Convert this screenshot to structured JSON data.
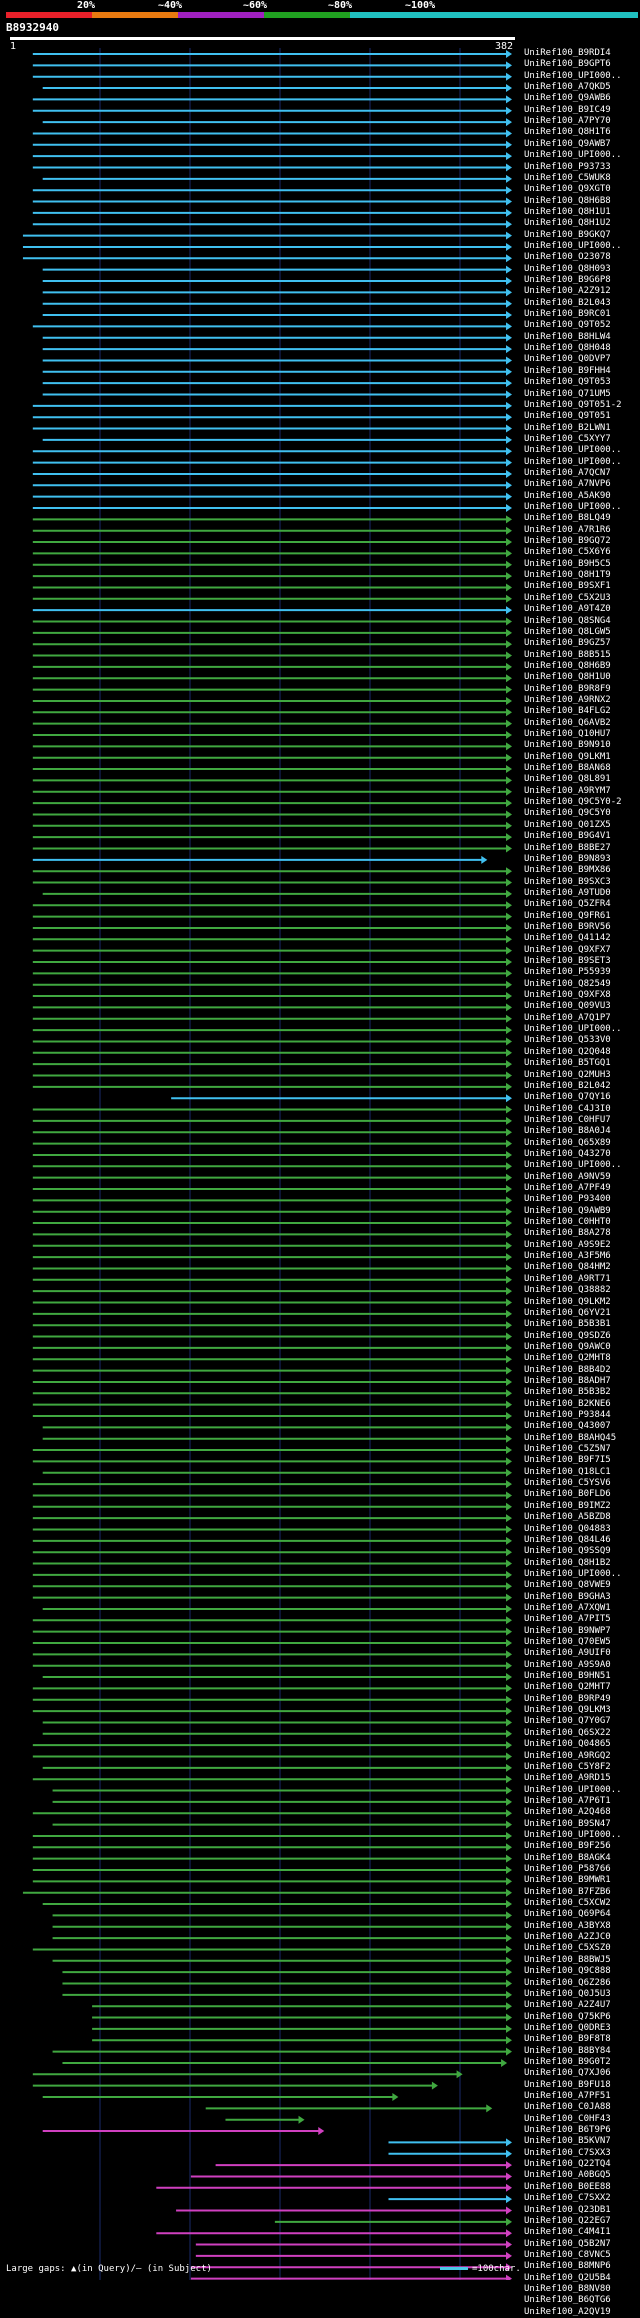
{
  "header": {
    "percent_labels": [
      "20%",
      "~40%",
      "~60%",
      "~80%",
      "~100%"
    ],
    "identity_colors": [
      "#e8202a",
      "#e87a10",
      "#a020c0",
      "#20a020",
      "#20c0c0"
    ],
    "query_id": "B8932940",
    "query_start": "1",
    "query_end": "382"
  },
  "colors": {
    "cyan": "#40c0f0",
    "green": "#40a840",
    "magenta": "#d040c0",
    "grid": "#1a2a6a"
  },
  "rows": [
    {
      "id": "UniRef100_B9RDI4",
      "c": "cyan",
      "s": 0.03,
      "e": 1.0
    },
    {
      "id": "UniRef100_B9GPT6",
      "c": "cyan",
      "s": 0.03,
      "e": 1.0
    },
    {
      "id": "UniRef100_UPI000..",
      "c": "cyan",
      "s": 0.03,
      "e": 1.0
    },
    {
      "id": "UniRef100_A7QKD5",
      "c": "cyan",
      "s": 0.05,
      "e": 1.0
    },
    {
      "id": "UniRef100_Q9AWB6",
      "c": "cyan",
      "s": 0.03,
      "e": 1.0
    },
    {
      "id": "UniRef100_B9IC49",
      "c": "cyan",
      "s": 0.03,
      "e": 1.0
    },
    {
      "id": "UniRef100_A7PY70",
      "c": "cyan",
      "s": 0.05,
      "e": 1.0
    },
    {
      "id": "UniRef100_Q8H1T6",
      "c": "cyan",
      "s": 0.03,
      "e": 1.0
    },
    {
      "id": "UniRef100_Q9AWB7",
      "c": "cyan",
      "s": 0.03,
      "e": 1.0
    },
    {
      "id": "UniRef100_UPI000..",
      "c": "cyan",
      "s": 0.03,
      "e": 1.0
    },
    {
      "id": "UniRef100_P93733",
      "c": "cyan",
      "s": 0.03,
      "e": 1.0
    },
    {
      "id": "UniRef100_C5WUK8",
      "c": "cyan",
      "s": 0.05,
      "e": 1.0
    },
    {
      "id": "UniRef100_Q9XGT0",
      "c": "cyan",
      "s": 0.03,
      "e": 1.0
    },
    {
      "id": "UniRef100_Q8H6B8",
      "c": "cyan",
      "s": 0.03,
      "e": 1.0
    },
    {
      "id": "UniRef100_Q8H1U1",
      "c": "cyan",
      "s": 0.03,
      "e": 1.0
    },
    {
      "id": "UniRef100_Q8H1U2",
      "c": "cyan",
      "s": 0.03,
      "e": 1.0
    },
    {
      "id": "UniRef100_B9GKQ7",
      "c": "cyan",
      "s": 0.01,
      "e": 1.0
    },
    {
      "id": "UniRef100_UPI000..",
      "c": "cyan",
      "s": 0.01,
      "e": 1.0
    },
    {
      "id": "UniRef100_O23078",
      "c": "cyan",
      "s": 0.01,
      "e": 1.0
    },
    {
      "id": "UniRef100_Q8H093",
      "c": "cyan",
      "s": 0.05,
      "e": 1.0
    },
    {
      "id": "UniRef100_B9G6P8",
      "c": "cyan",
      "s": 0.05,
      "e": 1.0
    },
    {
      "id": "UniRef100_A2Z912",
      "c": "cyan",
      "s": 0.05,
      "e": 1.0
    },
    {
      "id": "UniRef100_B2L043",
      "c": "cyan",
      "s": 0.05,
      "e": 1.0
    },
    {
      "id": "UniRef100_B9RC01",
      "c": "cyan",
      "s": 0.05,
      "e": 1.0
    },
    {
      "id": "UniRef100_Q9T052",
      "c": "cyan",
      "s": 0.03,
      "e": 1.0
    },
    {
      "id": "UniRef100_B8HLW4",
      "c": "cyan",
      "s": 0.05,
      "e": 1.0
    },
    {
      "id": "UniRef100_Q8H048",
      "c": "cyan",
      "s": 0.05,
      "e": 1.0
    },
    {
      "id": "UniRef100_Q0DVP7",
      "c": "cyan",
      "s": 0.05,
      "e": 1.0
    },
    {
      "id": "UniRef100_B9FHH4",
      "c": "cyan",
      "s": 0.05,
      "e": 1.0
    },
    {
      "id": "UniRef100_Q9T053",
      "c": "cyan",
      "s": 0.05,
      "e": 1.0
    },
    {
      "id": "UniRef100_Q71UM5",
      "c": "cyan",
      "s": 0.05,
      "e": 1.0
    },
    {
      "id": "UniRef100_Q9T051-2",
      "c": "cyan",
      "s": 0.03,
      "e": 1.0
    },
    {
      "id": "UniRef100_Q9T051",
      "c": "cyan",
      "s": 0.03,
      "e": 1.0
    },
    {
      "id": "UniRef100_B2LWN1",
      "c": "cyan",
      "s": 0.03,
      "e": 1.0
    },
    {
      "id": "UniRef100_C5XYY7",
      "c": "cyan",
      "s": 0.05,
      "e": 1.0
    },
    {
      "id": "UniRef100_UPI000..",
      "c": "cyan",
      "s": 0.03,
      "e": 1.0
    },
    {
      "id": "UniRef100_UPI000..",
      "c": "cyan",
      "s": 0.03,
      "e": 1.0
    },
    {
      "id": "UniRef100_A7QCN7",
      "c": "cyan",
      "s": 0.03,
      "e": 1.0
    },
    {
      "id": "UniRef100_A7NVP6",
      "c": "cyan",
      "s": 0.03,
      "e": 1.0
    },
    {
      "id": "UniRef100_A5AK90",
      "c": "cyan",
      "s": 0.03,
      "e": 1.0
    },
    {
      "id": "UniRef100_UPI000..",
      "c": "cyan",
      "s": 0.03,
      "e": 1.0
    },
    {
      "id": "UniRef100_B8LQ49",
      "c": "green",
      "s": 0.03,
      "e": 1.0
    },
    {
      "id": "UniRef100_A7R1R6",
      "c": "green",
      "s": 0.03,
      "e": 1.0
    },
    {
      "id": "UniRef100_B9GQ72",
      "c": "green",
      "s": 0.03,
      "e": 1.0
    },
    {
      "id": "UniRef100_C5X6Y6",
      "c": "green",
      "s": 0.03,
      "e": 1.0
    },
    {
      "id": "UniRef100_B9H5C5",
      "c": "green",
      "s": 0.03,
      "e": 1.0
    },
    {
      "id": "UniRef100_Q8H1T9",
      "c": "green",
      "s": 0.03,
      "e": 1.0
    },
    {
      "id": "UniRef100_B9SXF1",
      "c": "green",
      "s": 0.03,
      "e": 1.0
    },
    {
      "id": "UniRef100_C5X2U3",
      "c": "green",
      "s": 0.03,
      "e": 1.0
    },
    {
      "id": "UniRef100_A9T4Z0",
      "c": "cyan",
      "s": 0.03,
      "e": 1.0
    },
    {
      "id": "UniRef100_Q8SNG4",
      "c": "green",
      "s": 0.03,
      "e": 1.0
    },
    {
      "id": "UniRef100_Q8LGW5",
      "c": "green",
      "s": 0.03,
      "e": 1.0
    },
    {
      "id": "UniRef100_B9GZ57",
      "c": "green",
      "s": 0.03,
      "e": 1.0
    },
    {
      "id": "UniRef100_B8B515",
      "c": "green",
      "s": 0.03,
      "e": 1.0
    },
    {
      "id": "UniRef100_Q8H6B9",
      "c": "green",
      "s": 0.03,
      "e": 1.0
    },
    {
      "id": "UniRef100_Q8H1U0",
      "c": "green",
      "s": 0.03,
      "e": 1.0
    },
    {
      "id": "UniRef100_B9R8F9",
      "c": "green",
      "s": 0.03,
      "e": 1.0
    },
    {
      "id": "UniRef100_A9RNX2",
      "c": "green",
      "s": 0.03,
      "e": 1.0
    },
    {
      "id": "UniRef100_B4FLG2",
      "c": "green",
      "s": 0.03,
      "e": 1.0
    },
    {
      "id": "UniRef100_Q6AVB2",
      "c": "green",
      "s": 0.03,
      "e": 1.0
    },
    {
      "id": "UniRef100_Q10HU7",
      "c": "green",
      "s": 0.03,
      "e": 1.0
    },
    {
      "id": "UniRef100_B9N910",
      "c": "green",
      "s": 0.03,
      "e": 1.0
    },
    {
      "id": "UniRef100_Q9LKM1",
      "c": "green",
      "s": 0.03,
      "e": 1.0
    },
    {
      "id": "UniRef100_B8AN68",
      "c": "green",
      "s": 0.03,
      "e": 1.0
    },
    {
      "id": "UniRef100_Q8L891",
      "c": "green",
      "s": 0.03,
      "e": 1.0
    },
    {
      "id": "UniRef100_A9RYM7",
      "c": "green",
      "s": 0.03,
      "e": 1.0
    },
    {
      "id": "UniRef100_Q9C5Y0-2",
      "c": "green",
      "s": 0.03,
      "e": 1.0
    },
    {
      "id": "UniRef100_Q9C5Y0",
      "c": "green",
      "s": 0.03,
      "e": 1.0
    },
    {
      "id": "UniRef100_Q01ZX5",
      "c": "green",
      "s": 0.03,
      "e": 1.0
    },
    {
      "id": "UniRef100_B9G4V1",
      "c": "green",
      "s": 0.03,
      "e": 1.0
    },
    {
      "id": "UniRef100_B8BE27",
      "c": "green",
      "s": 0.03,
      "e": 1.0
    },
    {
      "id": "UniRef100_B9N893",
      "c": "cyan",
      "s": 0.03,
      "e": 0.95
    },
    {
      "id": "UniRef100_B9MX86",
      "c": "green",
      "s": 0.03,
      "e": 1.0
    },
    {
      "id": "UniRef100_B9SXC3",
      "c": "green",
      "s": 0.03,
      "e": 1.0
    },
    {
      "id": "UniRef100_A9TUD0",
      "c": "green",
      "s": 0.05,
      "e": 1.0
    },
    {
      "id": "UniRef100_Q5ZFR4",
      "c": "green",
      "s": 0.03,
      "e": 1.0
    },
    {
      "id": "UniRef100_Q9FR61",
      "c": "green",
      "s": 0.03,
      "e": 1.0
    },
    {
      "id": "UniRef100_B9RV56",
      "c": "green",
      "s": 0.03,
      "e": 1.0
    },
    {
      "id": "UniRef100_Q41142",
      "c": "green",
      "s": 0.03,
      "e": 1.0
    },
    {
      "id": "UniRef100_Q9XFX7",
      "c": "green",
      "s": 0.03,
      "e": 1.0
    },
    {
      "id": "UniRef100_B9SET3",
      "c": "green",
      "s": 0.03,
      "e": 1.0
    },
    {
      "id": "UniRef100_P55939",
      "c": "green",
      "s": 0.03,
      "e": 1.0
    },
    {
      "id": "UniRef100_Q82549",
      "c": "green",
      "s": 0.03,
      "e": 1.0
    },
    {
      "id": "UniRef100_Q9XFX8",
      "c": "green",
      "s": 0.03,
      "e": 1.0
    },
    {
      "id": "UniRef100_Q09VU3",
      "c": "green",
      "s": 0.03,
      "e": 1.0
    },
    {
      "id": "UniRef100_A7Q1P7",
      "c": "green",
      "s": 0.03,
      "e": 1.0
    },
    {
      "id": "UniRef100_UPI000..",
      "c": "green",
      "s": 0.03,
      "e": 1.0
    },
    {
      "id": "UniRef100_Q533V0",
      "c": "green",
      "s": 0.03,
      "e": 1.0
    },
    {
      "id": "UniRef100_Q2Q048",
      "c": "green",
      "s": 0.03,
      "e": 1.0
    },
    {
      "id": "UniRef100_B5TGQ1",
      "c": "green",
      "s": 0.03,
      "e": 1.0
    },
    {
      "id": "UniRef100_Q2MUH3",
      "c": "green",
      "s": 0.03,
      "e": 1.0
    },
    {
      "id": "UniRef100_B2L042",
      "c": "green",
      "s": 0.03,
      "e": 1.0
    },
    {
      "id": "UniRef100_Q7QY16",
      "c": "cyan",
      "s": 0.31,
      "e": 1.0
    },
    {
      "id": "UniRef100_C4J3I0",
      "c": "green",
      "s": 0.03,
      "e": 1.0
    },
    {
      "id": "UniRef100_C0HFU7",
      "c": "green",
      "s": 0.03,
      "e": 1.0
    },
    {
      "id": "UniRef100_B8A0J4",
      "c": "green",
      "s": 0.03,
      "e": 1.0
    },
    {
      "id": "UniRef100_Q65X89",
      "c": "green",
      "s": 0.03,
      "e": 1.0
    },
    {
      "id": "UniRef100_Q43270",
      "c": "green",
      "s": 0.03,
      "e": 1.0
    },
    {
      "id": "UniRef100_UPI000..",
      "c": "green",
      "s": 0.03,
      "e": 1.0
    },
    {
      "id": "UniRef100_A9NV59",
      "c": "green",
      "s": 0.03,
      "e": 1.0
    },
    {
      "id": "UniRef100_A7PF49",
      "c": "green",
      "s": 0.03,
      "e": 1.0
    },
    {
      "id": "UniRef100_P93400",
      "c": "green",
      "s": 0.03,
      "e": 1.0
    },
    {
      "id": "UniRef100_Q9AWB9",
      "c": "green",
      "s": 0.03,
      "e": 1.0
    },
    {
      "id": "UniRef100_C0HHT0",
      "c": "green",
      "s": 0.03,
      "e": 1.0
    },
    {
      "id": "UniRef100_B8A278",
      "c": "green",
      "s": 0.03,
      "e": 1.0
    },
    {
      "id": "UniRef100_A9S9E2",
      "c": "green",
      "s": 0.03,
      "e": 1.0
    },
    {
      "id": "UniRef100_A3F5M6",
      "c": "green",
      "s": 0.03,
      "e": 1.0
    },
    {
      "id": "UniRef100_Q84HM2",
      "c": "green",
      "s": 0.03,
      "e": 1.0
    },
    {
      "id": "UniRef100_A9RT71",
      "c": "green",
      "s": 0.03,
      "e": 1.0
    },
    {
      "id": "UniRef100_Q38882",
      "c": "green",
      "s": 0.03,
      "e": 1.0
    },
    {
      "id": "UniRef100_Q9LKM2",
      "c": "green",
      "s": 0.03,
      "e": 1.0
    },
    {
      "id": "UniRef100_Q6YV21",
      "c": "green",
      "s": 0.03,
      "e": 1.0
    },
    {
      "id": "UniRef100_B5B3B1",
      "c": "green",
      "s": 0.03,
      "e": 1.0
    },
    {
      "id": "UniRef100_Q9SDZ6",
      "c": "green",
      "s": 0.03,
      "e": 1.0
    },
    {
      "id": "UniRef100_Q9AWC0",
      "c": "green",
      "s": 0.03,
      "e": 1.0
    },
    {
      "id": "UniRef100_Q2MHT8",
      "c": "green",
      "s": 0.03,
      "e": 1.0
    },
    {
      "id": "UniRef100_B8B4D2",
      "c": "green",
      "s": 0.03,
      "e": 1.0
    },
    {
      "id": "UniRef100_B8ADH7",
      "c": "green",
      "s": 0.03,
      "e": 1.0
    },
    {
      "id": "UniRef100_B5B3B2",
      "c": "green",
      "s": 0.03,
      "e": 1.0
    },
    {
      "id": "UniRef100_B2KNE6",
      "c": "green",
      "s": 0.03,
      "e": 1.0
    },
    {
      "id": "UniRef100_P93844",
      "c": "green",
      "s": 0.03,
      "e": 1.0
    },
    {
      "id": "UniRef100_Q43007",
      "c": "green",
      "s": 0.05,
      "e": 1.0
    },
    {
      "id": "UniRef100_B8AHQ45",
      "c": "green",
      "s": 0.05,
      "e": 1.0
    },
    {
      "id": "UniRef100_C5Z5N7",
      "c": "green",
      "s": 0.03,
      "e": 1.0
    },
    {
      "id": "UniRef100_B9F7I5",
      "c": "green",
      "s": 0.03,
      "e": 1.0
    },
    {
      "id": "UniRef100_Q18LC1",
      "c": "green",
      "s": 0.05,
      "e": 1.0
    },
    {
      "id": "UniRef100_C5YSV6",
      "c": "green",
      "s": 0.03,
      "e": 1.0
    },
    {
      "id": "UniRef100_B0FLD6",
      "c": "green",
      "s": 0.03,
      "e": 1.0
    },
    {
      "id": "UniRef100_B9IMZ2",
      "c": "green",
      "s": 0.03,
      "e": 1.0
    },
    {
      "id": "UniRef100_A5BZD8",
      "c": "green",
      "s": 0.03,
      "e": 1.0
    },
    {
      "id": "UniRef100_Q04883",
      "c": "green",
      "s": 0.03,
      "e": 1.0
    },
    {
      "id": "UniRef100_Q84L46",
      "c": "green",
      "s": 0.03,
      "e": 1.0
    },
    {
      "id": "UniRef100_Q9SSQ9",
      "c": "green",
      "s": 0.03,
      "e": 1.0
    },
    {
      "id": "UniRef100_Q8H1B2",
      "c": "green",
      "s": 0.03,
      "e": 1.0
    },
    {
      "id": "UniRef100_UPI000..",
      "c": "green",
      "s": 0.03,
      "e": 1.0
    },
    {
      "id": "UniRef100_Q8VWE9",
      "c": "green",
      "s": 0.03,
      "e": 1.0
    },
    {
      "id": "UniRef100_B9GHA3",
      "c": "green",
      "s": 0.03,
      "e": 1.0
    },
    {
      "id": "UniRef100_A7XQW1",
      "c": "green",
      "s": 0.05,
      "e": 1.0
    },
    {
      "id": "UniRef100_A7PIT5",
      "c": "green",
      "s": 0.03,
      "e": 1.0
    },
    {
      "id": "UniRef100_B9NWP7",
      "c": "green",
      "s": 0.03,
      "e": 1.0
    },
    {
      "id": "UniRef100_Q70EW5",
      "c": "green",
      "s": 0.03,
      "e": 1.0
    },
    {
      "id": "UniRef100_A9UIF0",
      "c": "green",
      "s": 0.03,
      "e": 1.0
    },
    {
      "id": "UniRef100_A9S9A0",
      "c": "green",
      "s": 0.03,
      "e": 1.0
    },
    {
      "id": "UniRef100_B9HN51",
      "c": "green",
      "s": 0.05,
      "e": 1.0
    },
    {
      "id": "UniRef100_Q2MHT7",
      "c": "green",
      "s": 0.03,
      "e": 1.0
    },
    {
      "id": "UniRef100_B9RP49",
      "c": "green",
      "s": 0.03,
      "e": 1.0
    },
    {
      "id": "UniRef100_Q9LKM3",
      "c": "green",
      "s": 0.03,
      "e": 1.0
    },
    {
      "id": "UniRef100_Q7Y0G7",
      "c": "green",
      "s": 0.05,
      "e": 1.0
    },
    {
      "id": "UniRef100_Q6SX22",
      "c": "green",
      "s": 0.05,
      "e": 1.0
    },
    {
      "id": "UniRef100_Q04865",
      "c": "green",
      "s": 0.03,
      "e": 1.0
    },
    {
      "id": "UniRef100_A9RGQ2",
      "c": "green",
      "s": 0.03,
      "e": 1.0
    },
    {
      "id": "UniRef100_C5Y8F2",
      "c": "green",
      "s": 0.05,
      "e": 1.0
    },
    {
      "id": "UniRef100_A9RD15",
      "c": "green",
      "s": 0.03,
      "e": 1.0
    },
    {
      "id": "UniRef100_UPI000..",
      "c": "green",
      "s": 0.07,
      "e": 1.0
    },
    {
      "id": "UniRef100_A7P6T1",
      "c": "green",
      "s": 0.07,
      "e": 1.0
    },
    {
      "id": "UniRef100_A2Q468",
      "c": "green",
      "s": 0.03,
      "e": 1.0
    },
    {
      "id": "UniRef100_B9SN47",
      "c": "green",
      "s": 0.07,
      "e": 1.0
    },
    {
      "id": "UniRef100_UPI000..",
      "c": "green",
      "s": 0.03,
      "e": 1.0
    },
    {
      "id": "UniRef100_B9F256",
      "c": "green",
      "s": 0.03,
      "e": 1.0
    },
    {
      "id": "UniRef100_B8AGK4",
      "c": "green",
      "s": 0.03,
      "e": 1.0
    },
    {
      "id": "UniRef100_P58766",
      "c": "green",
      "s": 0.03,
      "e": 1.0
    },
    {
      "id": "UniRef100_B9MWR1",
      "c": "green",
      "s": 0.03,
      "e": 1.0
    },
    {
      "id": "UniRef100_B7FZB6",
      "c": "green",
      "s": 0.01,
      "e": 1.0
    },
    {
      "id": "UniRef100_C5XCW2",
      "c": "green",
      "s": 0.05,
      "e": 1.0
    },
    {
      "id": "UniRef100_Q69P64",
      "c": "green",
      "s": 0.07,
      "e": 1.0
    },
    {
      "id": "UniRef100_A3BYX8",
      "c": "green",
      "s": 0.07,
      "e": 1.0
    },
    {
      "id": "UniRef100_A2ZJC0",
      "c": "green",
      "s": 0.07,
      "e": 1.0
    },
    {
      "id": "UniRef100_C5XSZ0",
      "c": "green",
      "s": 0.03,
      "e": 1.0
    },
    {
      "id": "UniRef100_B8BWJ5",
      "c": "green",
      "s": 0.07,
      "e": 1.0
    },
    {
      "id": "UniRef100_Q9C888",
      "c": "green",
      "s": 0.09,
      "e": 1.0
    },
    {
      "id": "UniRef100_Q6Z286",
      "c": "green",
      "s": 0.09,
      "e": 1.0
    },
    {
      "id": "UniRef100_Q0J5U3",
      "c": "green",
      "s": 0.09,
      "e": 1.0
    },
    {
      "id": "UniRef100_A2Z4U7",
      "c": "green",
      "s": 0.15,
      "e": 1.0
    },
    {
      "id": "UniRef100_Q75KP6",
      "c": "green",
      "s": 0.15,
      "e": 1.0
    },
    {
      "id": "UniRef100_Q0DRE3",
      "c": "green",
      "s": 0.15,
      "e": 1.0
    },
    {
      "id": "UniRef100_B9F8T8",
      "c": "green",
      "s": 0.15,
      "e": 1.0
    },
    {
      "id": "UniRef100_B8BY84",
      "c": "green",
      "s": 0.07,
      "e": 1.0
    },
    {
      "id": "UniRef100_B9G0T2",
      "c": "green",
      "s": 0.09,
      "e": 0.99
    },
    {
      "id": "UniRef100_Q7XJ06",
      "c": "green",
      "s": 0.03,
      "e": 0.9
    },
    {
      "id": "UniRef100_B9FU18",
      "c": "green",
      "s": 0.03,
      "e": 0.85
    },
    {
      "id": "UniRef100_A7PF51",
      "c": "green",
      "s": 0.05,
      "e": 0.77
    },
    {
      "id": "UniRef100_C0JA88",
      "c": "green",
      "s": 0.38,
      "e": 0.96
    },
    {
      "id": "UniRef100_C0HF43",
      "c": "green",
      "s": 0.42,
      "e": 0.58
    },
    {
      "id": "UniRef100_B6T9P6",
      "c": "magenta",
      "s": 0.05,
      "e": 0.62
    },
    {
      "id": "UniRef100_B5KVN7",
      "c": "cyan",
      "s": 0.75,
      "e": 1.0
    },
    {
      "id": "UniRef100_C7SXX3",
      "c": "cyan",
      "s": 0.75,
      "e": 1.0
    },
    {
      "id": "UniRef100_Q22TQ4",
      "c": "magenta",
      "s": 0.4,
      "e": 1.0
    },
    {
      "id": "UniRef100_A0BGQ5",
      "c": "magenta",
      "s": 0.35,
      "e": 1.0
    },
    {
      "id": "UniRef100_B0EE88",
      "c": "magenta",
      "s": 0.28,
      "e": 1.0
    },
    {
      "id": "UniRef100_C7SXX2",
      "c": "cyan",
      "s": 0.75,
      "e": 1.0
    },
    {
      "id": "UniRef100_Q23DB1",
      "c": "magenta",
      "s": 0.32,
      "e": 1.0
    },
    {
      "id": "UniRef100_Q22EG7",
      "c": "green",
      "s": 0.52,
      "e": 1.0
    },
    {
      "id": "UniRef100_C4M4I1",
      "c": "magenta",
      "s": 0.28,
      "e": 1.0
    },
    {
      "id": "UniRef100_Q5B2N7",
      "c": "magenta",
      "s": 0.36,
      "e": 1.0
    },
    {
      "id": "UniRef100_C8VNC5",
      "c": "magenta",
      "s": 0.36,
      "e": 1.0
    },
    {
      "id": "UniRef100_B8MNP6",
      "c": "magenta",
      "s": 0.35,
      "e": 1.0
    },
    {
      "id": "UniRef100_Q2U5B4",
      "c": "magenta",
      "s": 0.35,
      "e": 1.0
    },
    {
      "id": "UniRef100_B8NV80",
      "c": "magenta",
      "s": 0.35,
      "e": 1.0
    },
    {
      "id": "UniRef100_B6QTG6",
      "c": "magenta",
      "s": 0.34,
      "e": 1.0
    },
    {
      "id": "UniRef100_A2QV19",
      "c": "magenta",
      "s": 0.33,
      "e": 1.0
    }
  ],
  "footer": {
    "text": "Large gaps: ▲(in Query)/– (in Subject)",
    "legend": "=100char."
  }
}
